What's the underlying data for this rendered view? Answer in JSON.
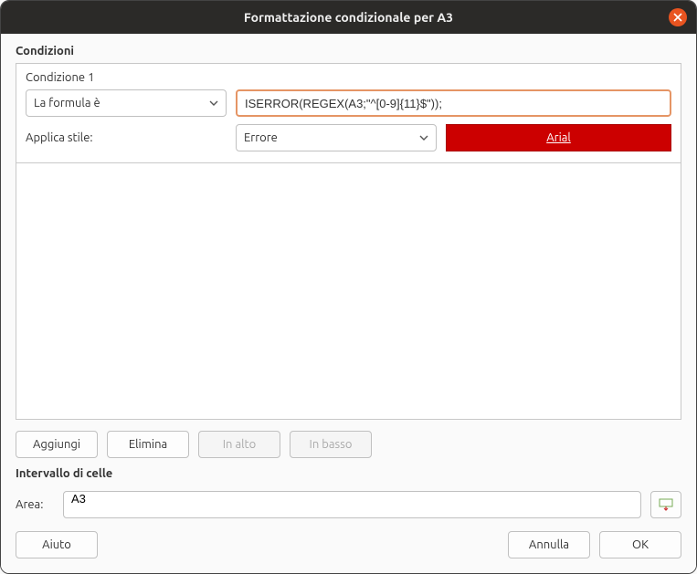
{
  "titlebar": {
    "title": "Formattazione condizionale per A3"
  },
  "sections": {
    "conditions_header": "Condizioni",
    "range_header": "Intervallo di celle"
  },
  "condition": {
    "title": "Condizione 1",
    "type_selected": "La formula è",
    "formula_value": "ISERROR(REGEX(A3;\"^[0-9]{11}$\"));",
    "apply_style_label": "Applica stile:",
    "style_selected": "Errore",
    "preview_text": "Arial"
  },
  "buttons": {
    "add": "Aggiungi",
    "delete": "Elimina",
    "up": "In alto",
    "down": "In basso",
    "help": "Aiuto",
    "cancel": "Annulla",
    "ok": "OK"
  },
  "range": {
    "label": "Area:",
    "value": "A3"
  },
  "colors": {
    "preview_bg": "#cc0000",
    "accent": "#e95420"
  }
}
